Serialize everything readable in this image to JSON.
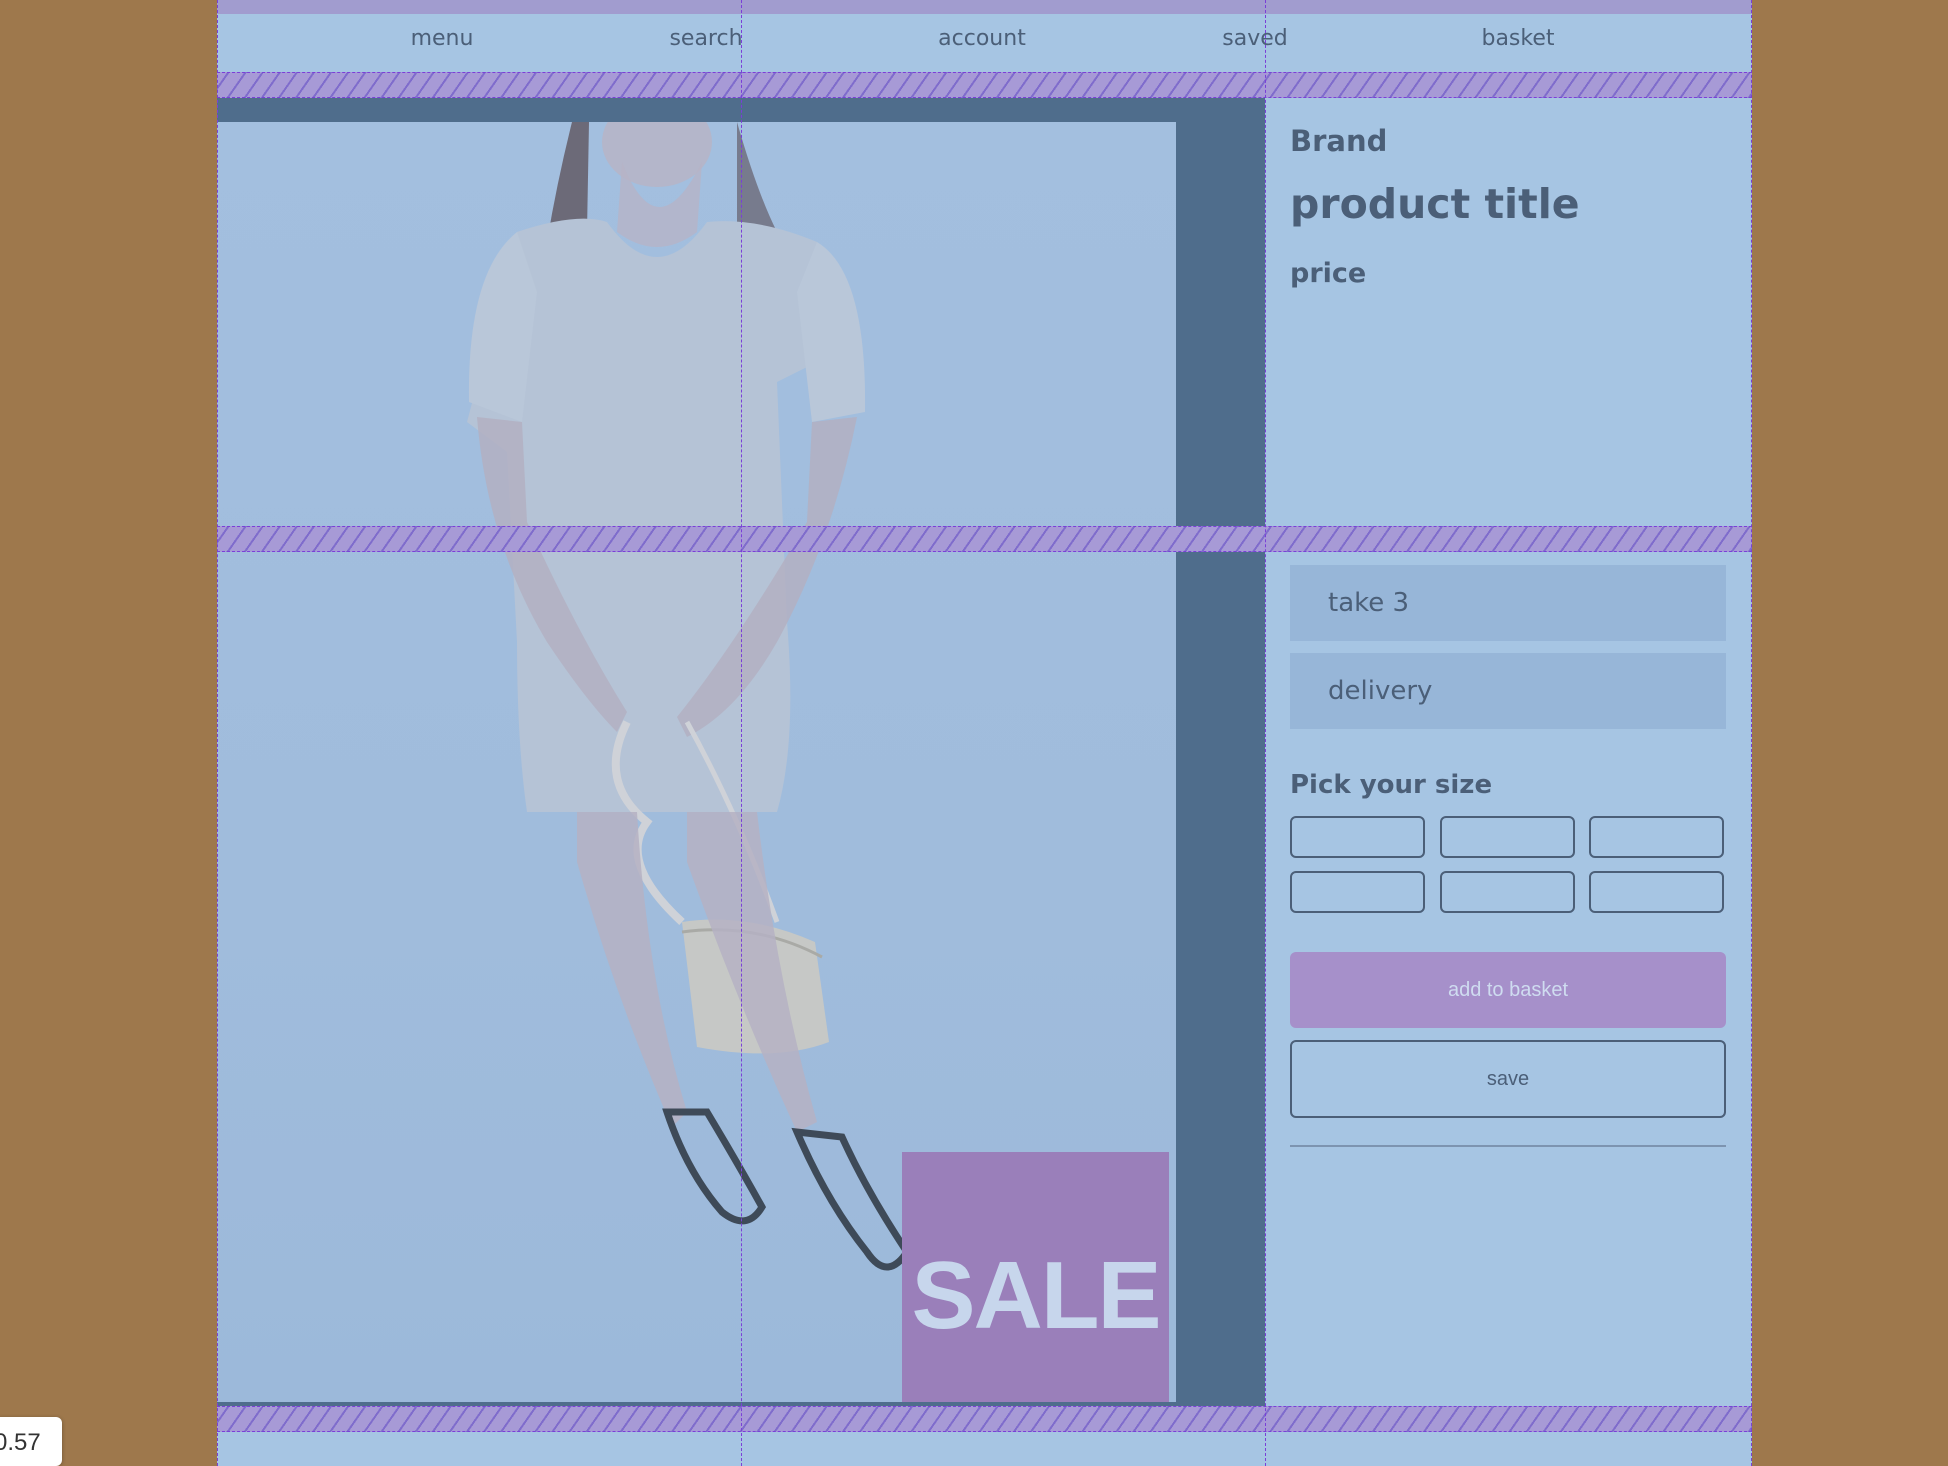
{
  "nav": {
    "menu": "menu",
    "search": "search",
    "account": "account",
    "saved": "saved",
    "basket": "basket"
  },
  "product": {
    "brand": "Brand",
    "title": "product title",
    "price": "price"
  },
  "promos": {
    "take3": "take 3",
    "delivery": "delivery"
  },
  "sale_badge": "SALE",
  "sizes": {
    "label": "Pick your size",
    "options": [
      "",
      "",
      "",
      "",
      "",
      ""
    ]
  },
  "actions": {
    "add": "add to basket",
    "save": "save"
  },
  "overlay": {
    "readout": "0.57"
  },
  "colors": {
    "page_bg": "#9e784c",
    "content": "#a6c5e3",
    "accent": "#a690ca",
    "text": "#4b5f78"
  }
}
